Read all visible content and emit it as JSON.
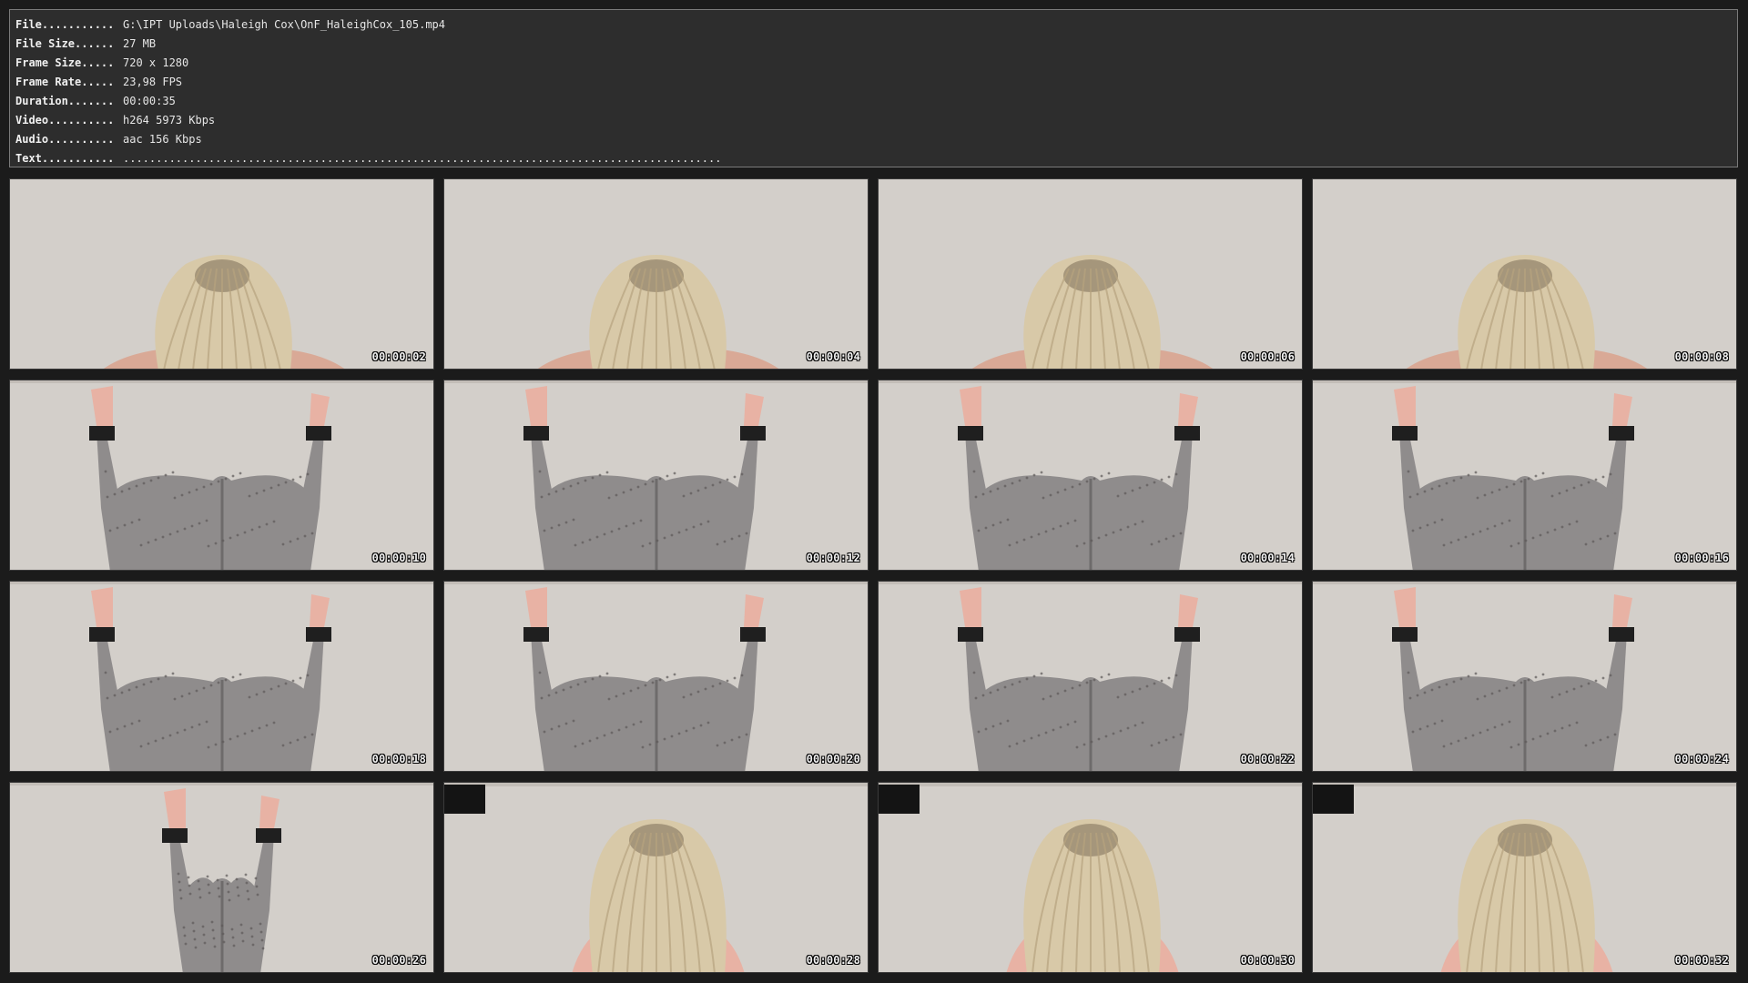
{
  "info": [
    {
      "key": "File...........",
      "value": "G:\\IPT Uploads\\Haleigh Cox\\OnF_HaleighCox_105.mp4"
    },
    {
      "key": "File Size......",
      "value": "27 MB"
    },
    {
      "key": "Frame Size.....",
      "value": "720 x 1280"
    },
    {
      "key": "Frame Rate.....",
      "value": "23,98 FPS"
    },
    {
      "key": "Duration.......",
      "value": "00:00:35"
    },
    {
      "key": "Video..........",
      "value": "h264 5973 Kbps"
    },
    {
      "key": "Audio..........",
      "value": "aac 156 Kbps"
    },
    {
      "key": "Text...........",
      "value": "..........................................................................................."
    }
  ],
  "thumbnails": [
    {
      "timestamp": "00:00:02",
      "scene": "hair"
    },
    {
      "timestamp": "00:00:04",
      "scene": "hair"
    },
    {
      "timestamp": "00:00:06",
      "scene": "hair"
    },
    {
      "timestamp": "00:00:08",
      "scene": "hair"
    },
    {
      "timestamp": "00:00:10",
      "scene": "legs"
    },
    {
      "timestamp": "00:00:12",
      "scene": "legs"
    },
    {
      "timestamp": "00:00:14",
      "scene": "legs"
    },
    {
      "timestamp": "00:00:16",
      "scene": "legs"
    },
    {
      "timestamp": "00:00:18",
      "scene": "legs"
    },
    {
      "timestamp": "00:00:20",
      "scene": "legs"
    },
    {
      "timestamp": "00:00:22",
      "scene": "legs"
    },
    {
      "timestamp": "00:00:24",
      "scene": "legs"
    },
    {
      "timestamp": "00:00:26",
      "scene": "legs-close"
    },
    {
      "timestamp": "00:00:28",
      "scene": "hair-low"
    },
    {
      "timestamp": "00:00:30",
      "scene": "hair-low"
    },
    {
      "timestamp": "00:00:32",
      "scene": "hair-low"
    }
  ],
  "colors": {
    "background": "#1b1b1b",
    "panel": "#2d2d2d",
    "panel_border": "#7a7a7a",
    "wall": "#d3cfca",
    "hair": "#d8c9a8",
    "fabric": "#8f8c8c",
    "cuff": "#1f1f1f",
    "skin": "#e8b2a4"
  }
}
